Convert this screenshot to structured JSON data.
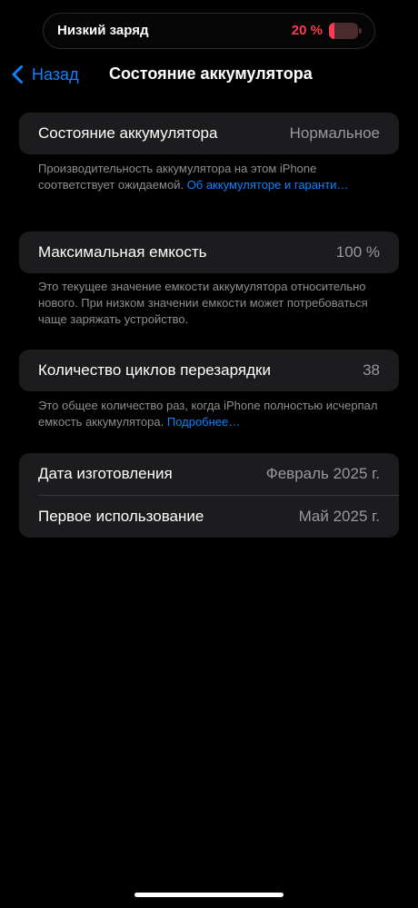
{
  "status": {
    "title": "Низкий заряд",
    "percent_label": "20 %",
    "battery_level": 0.2,
    "alert_color": "#ff3b4f"
  },
  "nav": {
    "back_label": "Назад",
    "title": "Состояние аккумулятора",
    "back_icon": "chevron-left-icon"
  },
  "health": {
    "label": "Состояние аккумулятора",
    "value": "Нормальное",
    "note_text": "Производительность аккумулятора на этом iPhone соответствует ожидаемой.",
    "note_link": "Об аккумуляторе и гаранти…"
  },
  "capacity": {
    "label": "Максимальная емкость",
    "value": "100 %",
    "note_text": "Это текущее значение емкости аккумулятора относительно нового. При низком значении емкости может потребоваться чаще заряжать устройство."
  },
  "cycles": {
    "label": "Количество циклов перезарядки",
    "value": "38",
    "note_text": "Это общее количество раз, когда iPhone полностью исчерпал емкость аккумулятора.",
    "note_link": "Подробнее…"
  },
  "dates": {
    "manufactured_label": "Дата изготовления",
    "manufactured_value": "Февраль 2025 г.",
    "first_use_label": "Первое использование",
    "first_use_value": "Май 2025 г."
  },
  "colors": {
    "background": "#000000",
    "card": "#1c1c1e",
    "accent": "#0a84ff",
    "secondary_text": "#98989f"
  }
}
